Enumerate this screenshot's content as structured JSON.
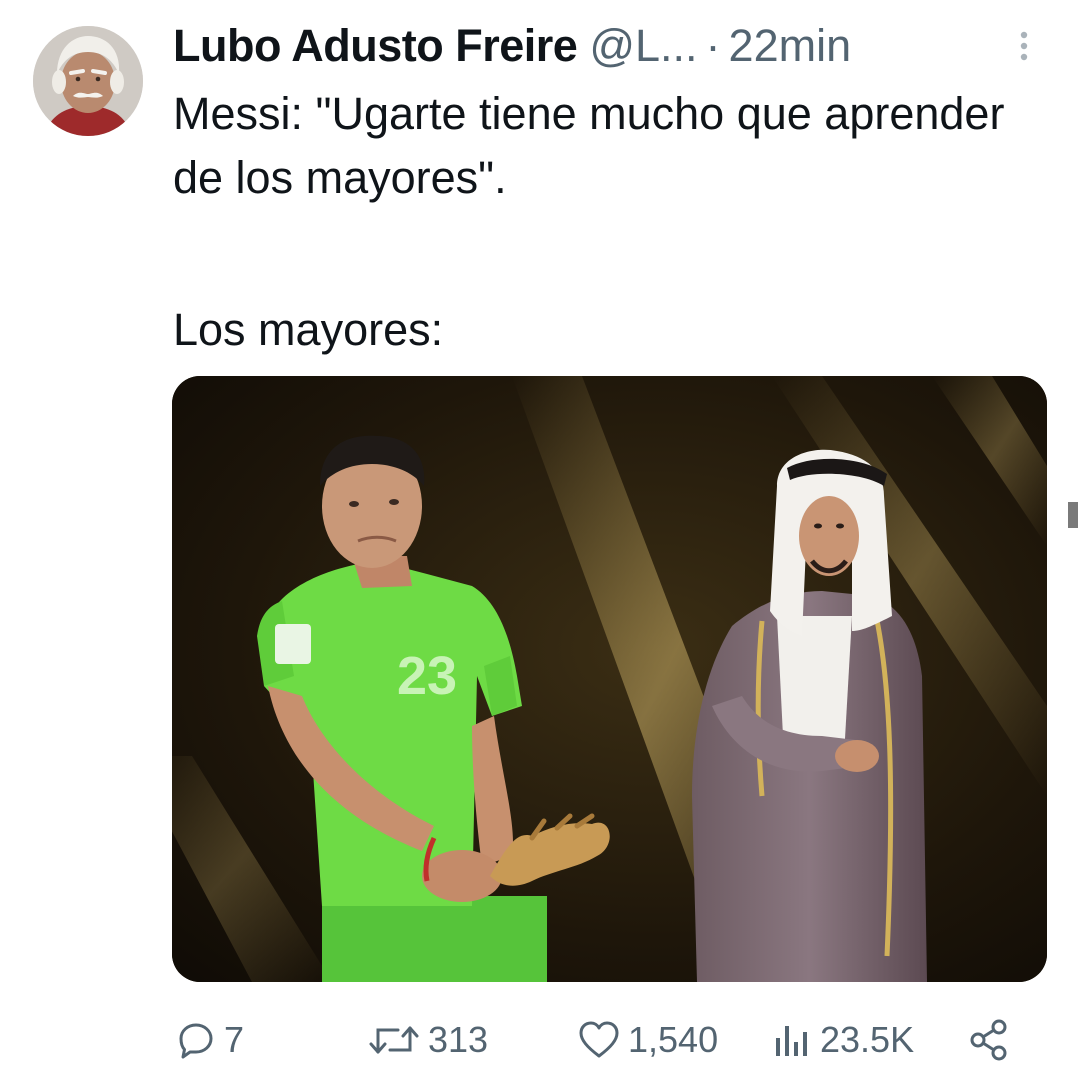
{
  "tweet": {
    "author": {
      "display_name": "Lubo Adusto Freire",
      "handle": "@L...",
      "separator": "·",
      "time": "22min",
      "avatar_icon": "elderly-man-avatar"
    },
    "text_lines": [
      "Messi: \"Ugarte tiene mucho que aprender de los mayores\".",
      "Los mayores:"
    ],
    "more_icon": "more-vertical-icon"
  },
  "actions": {
    "reply": {
      "icon": "reply-icon",
      "count": "7"
    },
    "retweet": {
      "icon": "retweet-icon",
      "count": "313"
    },
    "like": {
      "icon": "heart-icon",
      "count": "1,540"
    },
    "views": {
      "icon": "views-bar-chart-icon",
      "count": "23.5K"
    },
    "share": {
      "icon": "share-icon"
    }
  },
  "colors": {
    "text_primary": "#0f1419",
    "text_secondary": "#536471",
    "background": "#ffffff"
  }
}
